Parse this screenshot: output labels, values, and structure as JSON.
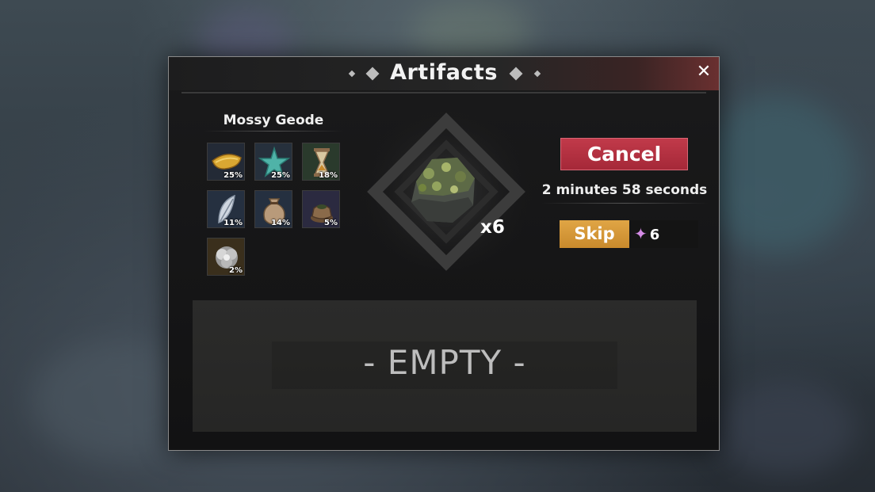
{
  "window": {
    "title": "Artifacts"
  },
  "drops": {
    "title": "Mossy Geode",
    "items": [
      {
        "icon": "banana-icon",
        "pct": "25%",
        "color": "#d9a732"
      },
      {
        "icon": "starfish-icon",
        "pct": "25%",
        "color": "#4fb3a8"
      },
      {
        "icon": "hourglass-icon",
        "pct": "18%",
        "color": "#c9a97a"
      },
      {
        "icon": "feather-icon",
        "pct": "11%",
        "color": "#cfd6e0"
      },
      {
        "icon": "sack-icon",
        "pct": "14%",
        "color": "#b89a7a"
      },
      {
        "icon": "clay-pot-icon",
        "pct": "5%",
        "color": "#8a6a4a"
      },
      {
        "icon": "silver-flower-icon",
        "pct": "2%",
        "color": "#c8c8c8"
      }
    ]
  },
  "crafting": {
    "item_icon": "mossy-geode-icon",
    "quantity": "x6",
    "cancel_label": "Cancel",
    "timer_text": "2 minutes 58 seconds",
    "skip_label": "Skip",
    "skip_cost": "6",
    "gem_icon": "gem-icon"
  },
  "queue": {
    "empty_text": "- EMPTY -"
  },
  "colors": {
    "cancel": "#b3303f",
    "skip": "#d89a38",
    "gem": "#d48be6"
  }
}
